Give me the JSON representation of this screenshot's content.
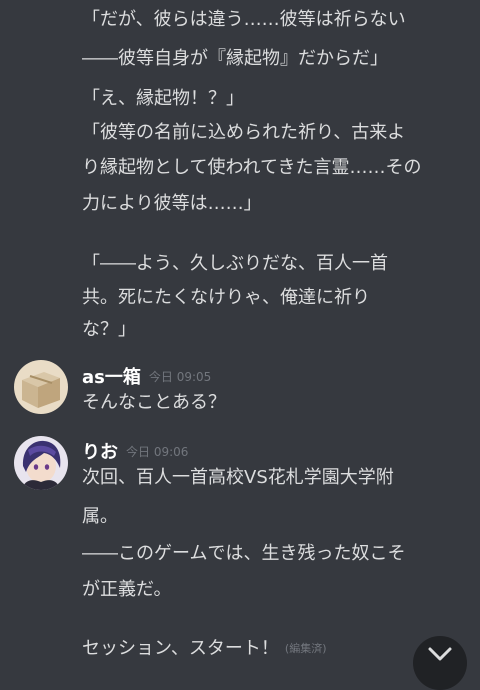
{
  "earlier_message": {
    "lines": [
      "「だが、彼らは違う……彼等は祈らない",
      "――彼等自身が『縁起物』だからだ」",
      "「え、縁起物！？」",
      "「彼等の名前に込められた祈り、古来よ",
      "り縁起物として使われてきた言霊……その",
      "力により彼等は……」",
      "「――よう、久しぶりだな、百人一首",
      "共。死にたくなけりゃ、俺達に祈り",
      "な？」"
    ]
  },
  "messages": [
    {
      "username": "as一箱",
      "timestamp": "今日 09:05",
      "avatar_icon": "cardboard-box-avatar",
      "lines": [
        "そんなことある？"
      ]
    },
    {
      "username": "りお",
      "timestamp": "今日 09:06",
      "avatar_icon": "anime-character-avatar",
      "lines": [
        "次回、百人一首高校VS花札学園大学附",
        "属。",
        "――このゲームでは、生き残った奴こそ",
        "が正義だ。",
        "セッション、スタート！"
      ],
      "edited_label": "(編集済)"
    }
  ],
  "scroll_button": {
    "icon": "chevron-down-icon"
  },
  "colors": {
    "background": "#36393f",
    "text": "#dcddde",
    "username": "#ffffff",
    "timestamp": "#72767d",
    "scroll_button_bg": "#202225"
  }
}
